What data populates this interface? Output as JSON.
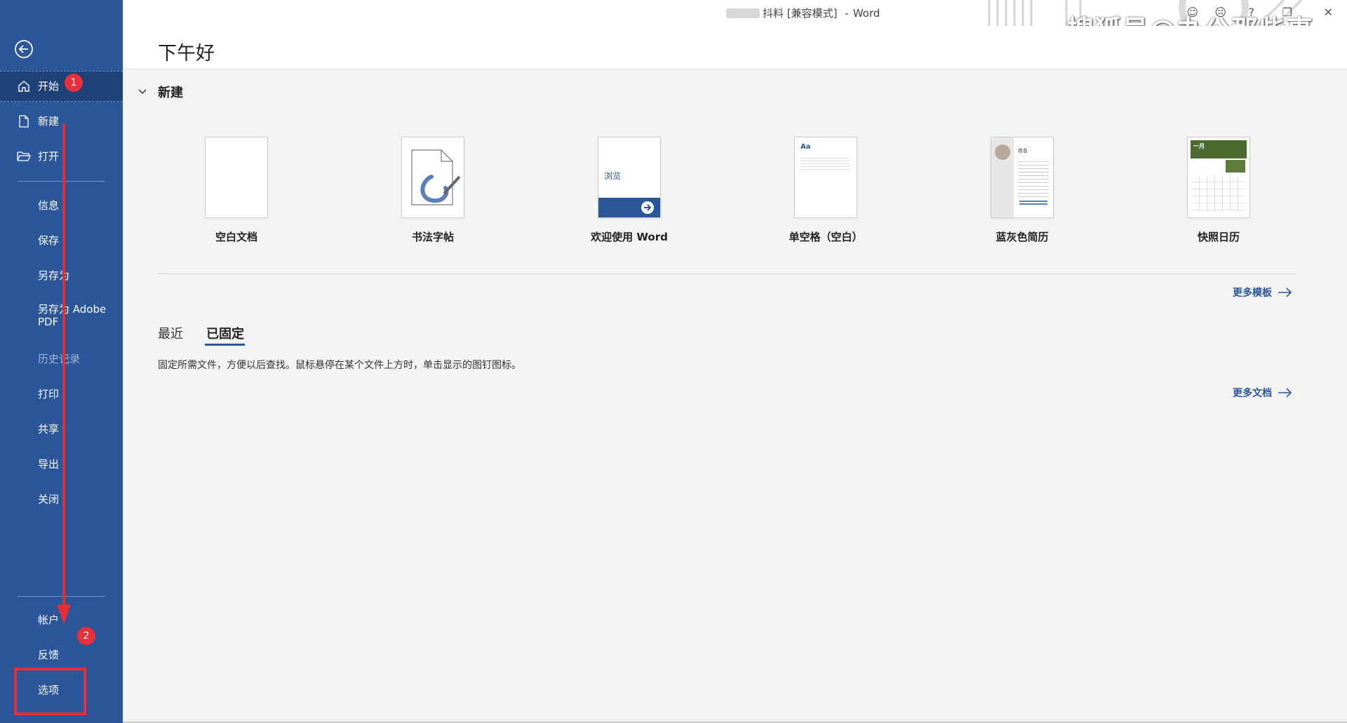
{
  "window": {
    "title_doc": "抖料 [兼容模式]",
    "title_sep": "-",
    "title_app": "Word"
  },
  "watermark": "搜狐号@办公那些事",
  "greeting": "下午好",
  "sidebar": {
    "back_label": "",
    "items": [
      {
        "label": "开始",
        "icon": "home-icon"
      },
      {
        "label": "新建",
        "icon": "new-doc-icon"
      },
      {
        "label": "打开",
        "icon": "open-folder-icon"
      },
      {
        "label": "信息"
      },
      {
        "label": "保存"
      },
      {
        "label": "另存为"
      },
      {
        "label": "另存为 Adobe PDF"
      },
      {
        "label": "历史记录"
      },
      {
        "label": "打印"
      },
      {
        "label": "共享"
      },
      {
        "label": "导出"
      },
      {
        "label": "关闭"
      }
    ],
    "bottom_items": [
      {
        "label": "帐户"
      },
      {
        "label": "反馈"
      },
      {
        "label": "选项"
      }
    ],
    "badges": [
      "1",
      "2"
    ]
  },
  "new_section": {
    "title": "新建",
    "templates": [
      {
        "label": "空白文档"
      },
      {
        "label": "书法字帖"
      },
      {
        "label": "欢迎使用 Word",
        "thumb_text": "浏览"
      },
      {
        "label": "单空格（空白）",
        "thumb_text": "Aa"
      },
      {
        "label": "蓝灰色简历",
        "thumb_text": "姓名"
      },
      {
        "label": "快照日历",
        "thumb_text": "一月"
      }
    ],
    "more_templates": "更多模板"
  },
  "docs_section": {
    "tabs": [
      "最近",
      "已固定"
    ],
    "selected_tab": "已固定",
    "hint": "固定所需文件，方便以后查找。鼠标悬停在某个文件上方时，单击显示的图钉图标。",
    "more_docs": "更多文档"
  },
  "colors": {
    "sidebar": "#2b579a",
    "accent": "#2b579a",
    "annotation": "#e62e35"
  }
}
